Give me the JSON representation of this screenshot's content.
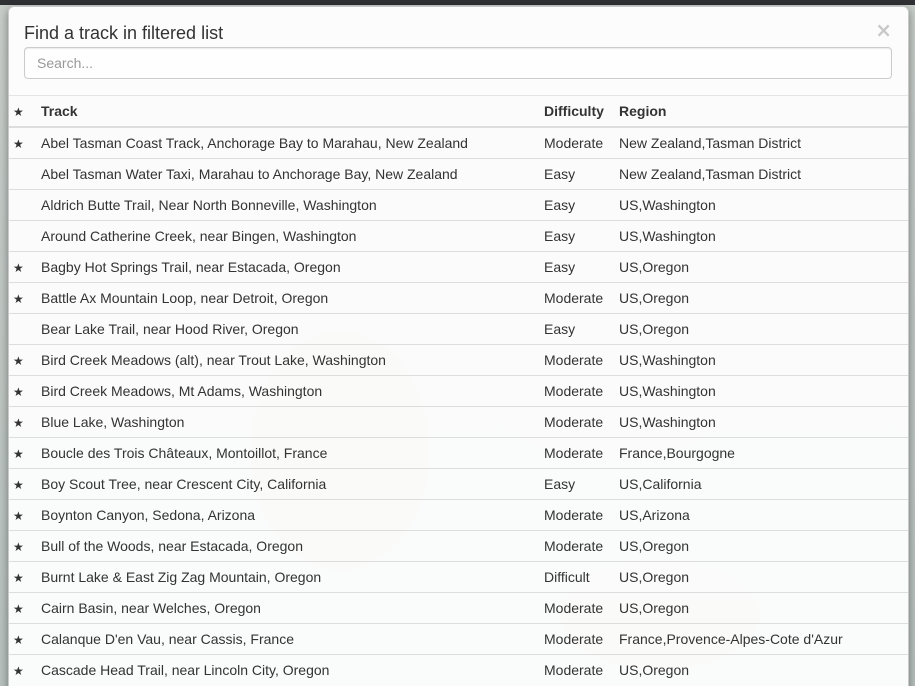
{
  "modal": {
    "title": "Find a track in filtered list",
    "close_label": "×",
    "search_placeholder": "Search..."
  },
  "table": {
    "headers": {
      "star": "★",
      "track": "Track",
      "difficulty": "Difficulty",
      "region": "Region"
    },
    "rows": [
      {
        "starred": true,
        "track": "Abel Tasman Coast Track, Anchorage Bay to Marahau, New Zealand",
        "difficulty": "Moderate",
        "region": "New Zealand,Tasman District"
      },
      {
        "starred": false,
        "track": "Abel Tasman Water Taxi, Marahau to Anchorage Bay, New Zealand",
        "difficulty": "Easy",
        "region": "New Zealand,Tasman District"
      },
      {
        "starred": false,
        "track": "Aldrich Butte Trail, Near North Bonneville, Washington",
        "difficulty": "Easy",
        "region": "US,Washington"
      },
      {
        "starred": false,
        "track": "Around Catherine Creek, near Bingen, Washington",
        "difficulty": "Easy",
        "region": "US,Washington"
      },
      {
        "starred": true,
        "track": "Bagby Hot Springs Trail, near Estacada, Oregon",
        "difficulty": "Easy",
        "region": "US,Oregon"
      },
      {
        "starred": true,
        "track": "Battle Ax Mountain Loop, near Detroit, Oregon",
        "difficulty": "Moderate",
        "region": "US,Oregon"
      },
      {
        "starred": false,
        "track": "Bear Lake Trail, near Hood River, Oregon",
        "difficulty": "Easy",
        "region": "US,Oregon"
      },
      {
        "starred": true,
        "track": "Bird Creek Meadows (alt), near Trout Lake, Washington",
        "difficulty": "Moderate",
        "region": "US,Washington"
      },
      {
        "starred": true,
        "track": "Bird Creek Meadows, Mt Adams, Washington",
        "difficulty": "Moderate",
        "region": "US,Washington"
      },
      {
        "starred": true,
        "track": "Blue Lake, Washington",
        "difficulty": "Moderate",
        "region": "US,Washington"
      },
      {
        "starred": true,
        "track": "Boucle des Trois Châteaux, Montoillot, France",
        "difficulty": "Moderate",
        "region": "France,Bourgogne"
      },
      {
        "starred": true,
        "track": "Boy Scout Tree, near Crescent City, California",
        "difficulty": "Easy",
        "region": "US,California"
      },
      {
        "starred": true,
        "track": "Boynton Canyon, Sedona, Arizona",
        "difficulty": "Moderate",
        "region": "US,Arizona"
      },
      {
        "starred": true,
        "track": "Bull of the Woods, near Estacada, Oregon",
        "difficulty": "Moderate",
        "region": "US,Oregon"
      },
      {
        "starred": true,
        "track": "Burnt Lake & East Zig Zag Mountain, Oregon",
        "difficulty": "Difficult",
        "region": "US,Oregon"
      },
      {
        "starred": true,
        "track": "Cairn Basin, near Welches, Oregon",
        "difficulty": "Moderate",
        "region": "US,Oregon"
      },
      {
        "starred": true,
        "track": "Calanque D'en Vau, near Cassis, France",
        "difficulty": "Moderate",
        "region": "France,Provence-Alpes-Cote d'Azur"
      },
      {
        "starred": true,
        "track": "Cascade Head Trail, near Lincoln City, Oregon",
        "difficulty": "Moderate",
        "region": "US,Oregon"
      }
    ]
  }
}
